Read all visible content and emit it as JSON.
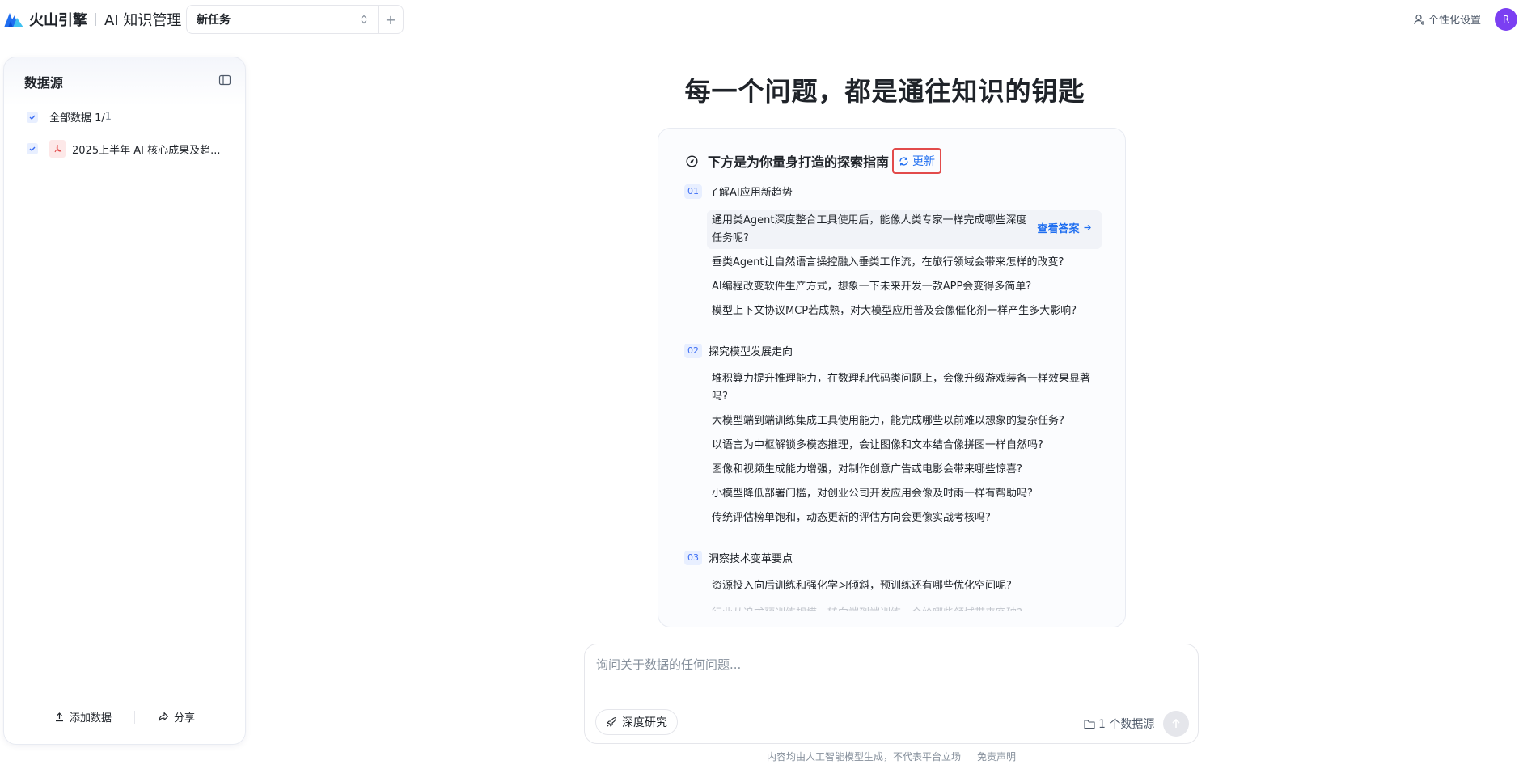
{
  "header": {
    "brand_name": "火山引擎",
    "product_name": "AI 知识管理",
    "task_select_value": "新任务",
    "add_task_symbol": "+",
    "personal_settings_label": "个性化设置",
    "avatar_initial": "R",
    "avatar_color": "#7b3ff2"
  },
  "sidebar": {
    "title": "数据源",
    "sources": [
      {
        "label": "全部数据 1/",
        "count": "1"
      },
      {
        "label": "2025上半年 AI 核心成果及趋...",
        "count": ""
      }
    ],
    "add_data_label": "添加数据",
    "share_label": "分享"
  },
  "main": {
    "headline": "每一个问题，都是通往知识的钥匙",
    "guide": {
      "title": "下方是为你量身打造的探索指南",
      "refresh_label": "更新",
      "view_answer_label": "查看答案",
      "sections": [
        {
          "num": "01",
          "title": "了解AI应用新趋势",
          "questions": [
            "通用类Agent深度整合工具使用后，能像人类专家一样完成哪些深度任务呢?",
            "垂类Agent让自然语言操控融入垂类工作流，在旅行领域会带来怎样的改变?",
            "AI编程改变软件生产方式，想象一下未来开发一款APP会变得多简单?",
            "模型上下文协议MCP若成熟，对大模型应用普及会像催化剂一样产生多大影响?"
          ]
        },
        {
          "num": "02",
          "title": "探究模型发展走向",
          "questions": [
            "堆积算力提升推理能力，在数理和代码类问题上，会像升级游戏装备一样效果显著吗?",
            "大模型端到端训练集成工具使用能力，能完成哪些以前难以想象的复杂任务?",
            "以语言为中枢解锁多模态推理，会让图像和文本结合像拼图一样自然吗?",
            "图像和视频生成能力增强，对制作创意广告或电影会带来哪些惊喜?",
            "小模型降低部署门槛，对创业公司开发应用会像及时雨一样有帮助吗?",
            "传统评估榜单饱和，动态更新的评估方向会更像实战考核吗?"
          ]
        },
        {
          "num": "03",
          "title": "洞察技术变革要点",
          "questions": [
            "资源投入向后训练和强化学习倾斜，预训练还有哪些优化空间呢?",
            "行业从追求预训练规模，转向端到端训练，会给哪些领域带来突破?"
          ]
        }
      ]
    }
  },
  "composer": {
    "placeholder": "询问关于数据的任何问题...",
    "deep_research_label": "深度研究",
    "source_count_label": "1 个数据源"
  },
  "footer": {
    "disclaimer_text": "内容均由人工智能模型生成，不代表平台立场",
    "disclaimer_link": "免责声明"
  },
  "colors": {
    "accent": "#1f6ef0",
    "highlight_border": "#e24b4b"
  }
}
